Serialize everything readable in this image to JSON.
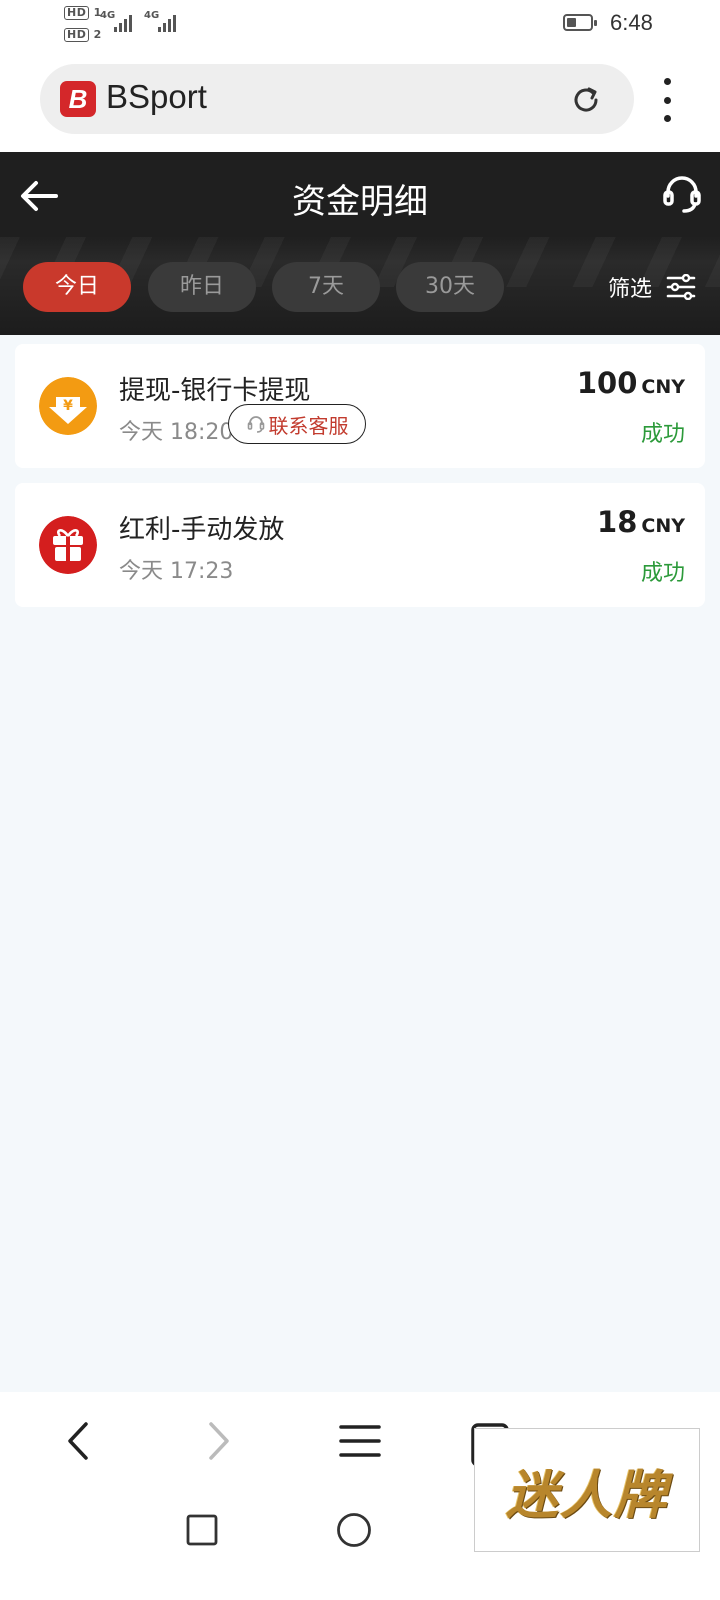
{
  "status_bar": {
    "sim1": "HD",
    "sim2": "HD",
    "net1": "4G",
    "net2": "4G",
    "time": "6:48"
  },
  "browser": {
    "site_logo_letter": "B",
    "site_title": "BSport"
  },
  "header": {
    "title": "资金明细"
  },
  "filters": {
    "chips": [
      {
        "label": "今日",
        "active": true
      },
      {
        "label": "昨日",
        "active": false
      },
      {
        "label": "7天",
        "active": false
      },
      {
        "label": "30天",
        "active": false
      }
    ],
    "filter_label": "筛选"
  },
  "records": [
    {
      "title": "提现-银行卡提现",
      "time": "今天 18:20",
      "amount": "100",
      "currency": "CNY",
      "status": "成功",
      "contact_label": "联系客服",
      "icon": "withdraw-yuan-icon"
    },
    {
      "title": "红利-手动发放",
      "time": "今天 17:23",
      "amount": "18",
      "currency": "CNY",
      "status": "成功",
      "icon": "gift-icon"
    }
  ],
  "watermark": {
    "text": "迷人牌"
  },
  "colors": {
    "accent": "#c9392c",
    "success": "#2c9a3a",
    "header_bg": "#1f1f1f",
    "page_bg": "#f4f8fb"
  }
}
